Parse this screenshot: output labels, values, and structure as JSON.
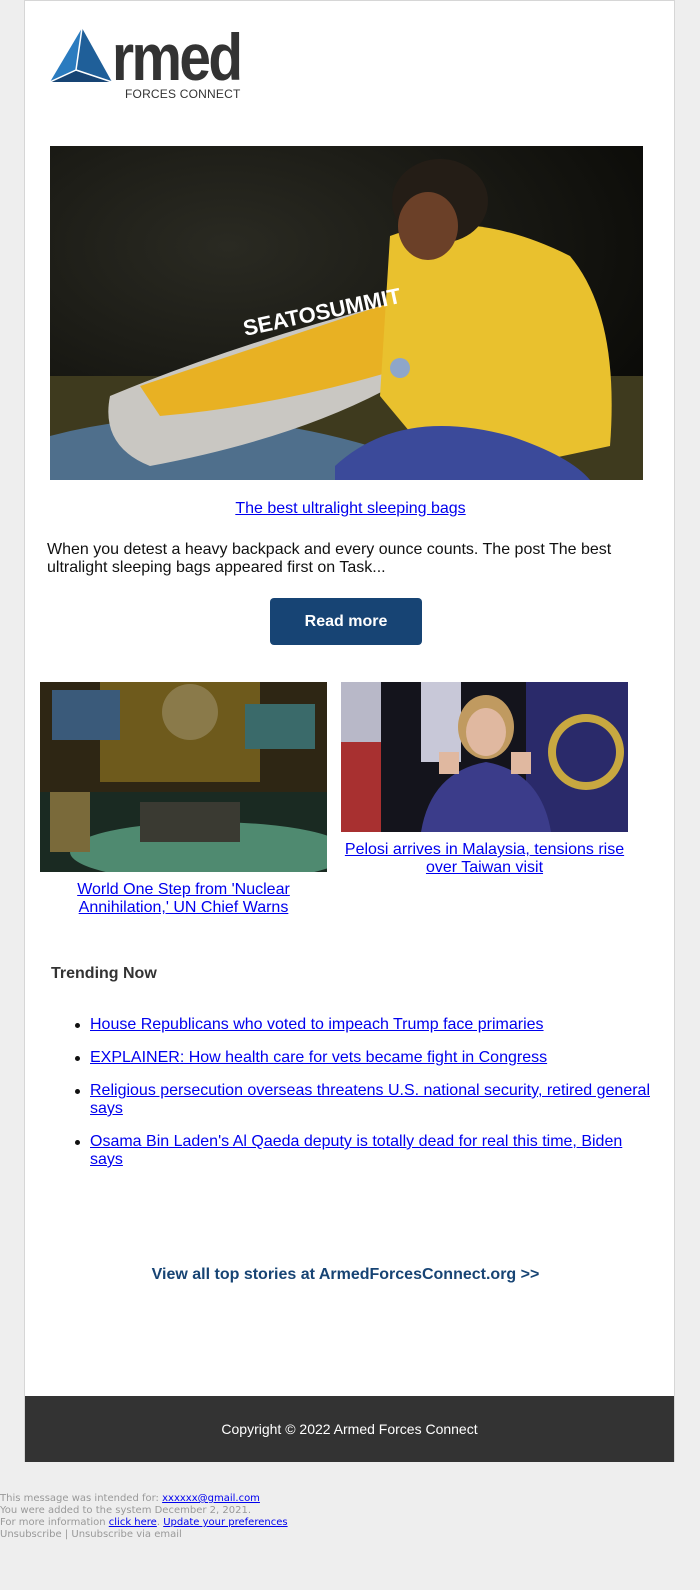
{
  "brand": {
    "logo_word": "rmed",
    "logo_subtitle": "FORCES CONNECT",
    "logo_colors": {
      "triangle_light": "#2a7bbf",
      "triangle_dark": "#174474",
      "text": "#333333"
    }
  },
  "hero": {
    "image_alt": "Man in yellow jacket with Sea to Summit sleeping bag",
    "image_brand_text": "SEATOSUMMIT",
    "title": "The best ultralight sleeping bags",
    "description": "When you detest a heavy backpack and every ounce counts. The post The best ultralight sleeping bags appeared first on Task...",
    "button_label": "Read more"
  },
  "cards": [
    {
      "image_alt": "UN General Assembly hall",
      "title": "World One Step from 'Nuclear Annihilation,' UN Chief Warns"
    },
    {
      "image_alt": "Nancy Pelosi speaking at podium",
      "title": "Pelosi arrives in Malaysia, tensions rise over Taiwan visit"
    }
  ],
  "trending": {
    "heading": "Trending Now",
    "items": [
      "House Republicans who voted to impeach Trump face primaries",
      "EXPLAINER: How health care for vets became fight in Congress",
      "Religious persecution overseas threatens U.S. national security, retired general says",
      "Osama Bin Laden's Al Qaeda deputy is totally dead for real this time, Biden says"
    ]
  },
  "view_all": "View all top stories at ArmedForcesConnect.org >>",
  "footer": {
    "copyright": "Copyright © 2022 Armed Forces Connect"
  },
  "fineprint": {
    "intended_prefix": "This message was intended for: ",
    "email": "xxxxxx@gmail.com",
    "added": "You were added to the system December 2, 2021.",
    "more_info_prefix": "For more information ",
    "click_here": "click here",
    "separator": ". ",
    "update_prefs": "Update your preferences",
    "unsubscribe": "Unsubscribe",
    "pipe": " | ",
    "unsubscribe_email": "Unsubscribe via email"
  },
  "colors": {
    "accent": "#174474",
    "link": "#0000ee",
    "footer_bg": "#333333",
    "page_bg": "#eeeeee"
  }
}
